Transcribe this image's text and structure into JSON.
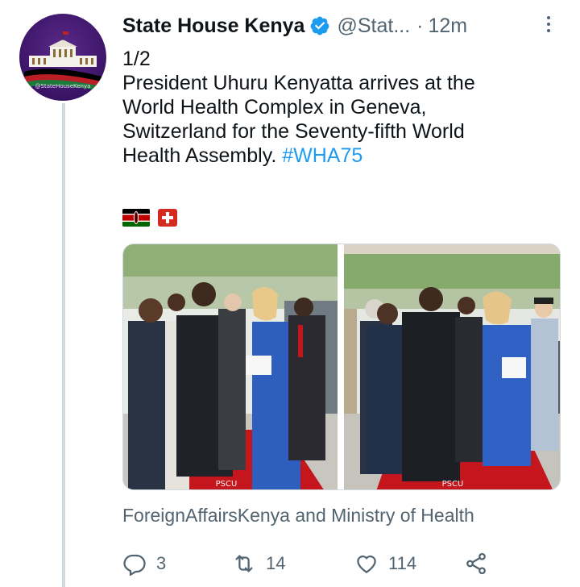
{
  "author": {
    "display_name": "State House Kenya",
    "handle": "@Stat...",
    "separator": "·",
    "timestamp": "12m",
    "avatar_caption": "@StateHouseKenya"
  },
  "tweet": {
    "lines": [
      "1/2",
      "President Uhuru Kenyatta arrives at the",
      "World Health Complex in Geneva,",
      "Switzerland for the Seventy-fifth World",
      "Health Assembly."
    ],
    "hashtag": "#WHA75",
    "flags": [
      "kenya-flag",
      "switzerland-flag"
    ]
  },
  "media": {
    "watermark_left": "PSCU",
    "watermark_right": "PSCU"
  },
  "attribution": "ForeignAffairsKenya and Ministry of Health",
  "actions": {
    "reply_count": "3",
    "retweet_count": "14",
    "like_count": "114"
  },
  "colors": {
    "accent": "#1d9bf0",
    "secondary_text": "#536471",
    "thread_line": "#cfd9de"
  }
}
